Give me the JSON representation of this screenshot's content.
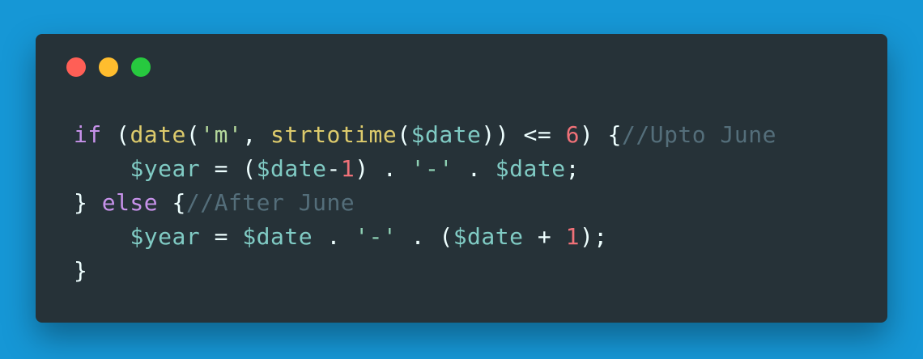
{
  "code": {
    "line1": {
      "kw_if": "if",
      "p1": " (",
      "fn_date": "date",
      "p2": "(",
      "str_m": "'m'",
      "p3": ", ",
      "fn_strtotime": "strtotime",
      "p4": "(",
      "var_date": "$date",
      "p5": ")) <= ",
      "num_6": "6",
      "p6": ") {",
      "comment": "//Upto June"
    },
    "line2": {
      "indent": "    ",
      "var_year": "$year",
      "p1": " = (",
      "var_date": "$date",
      "p2": "-",
      "num_1": "1",
      "p3": ") . ",
      "str_dash": "'-'",
      "p4": " . ",
      "var_date2": "$date",
      "p5": ";"
    },
    "line3": {
      "p1": "} ",
      "kw_else": "else",
      "p2": " {",
      "comment": "//After June"
    },
    "line4": {
      "indent": "    ",
      "var_year": "$year",
      "p1": " = ",
      "var_date": "$date",
      "p2": " . ",
      "str_dash": "'-'",
      "p3": " . (",
      "var_date2": "$date",
      "p4": " + ",
      "num_1": "1",
      "p5": ");"
    },
    "line5": {
      "p1": "}"
    }
  },
  "colors": {
    "background": "#1697d6",
    "window": "#263238",
    "dot_red": "#ff5f56",
    "dot_yellow": "#ffbd2e",
    "dot_green": "#27c93f",
    "keyword": "#c792ea",
    "function": "#ddcb6c",
    "variable": "#80cbc4",
    "string": "#b5d99c",
    "number": "#f07178",
    "comment": "#546e7a",
    "text": "#eeffff"
  }
}
